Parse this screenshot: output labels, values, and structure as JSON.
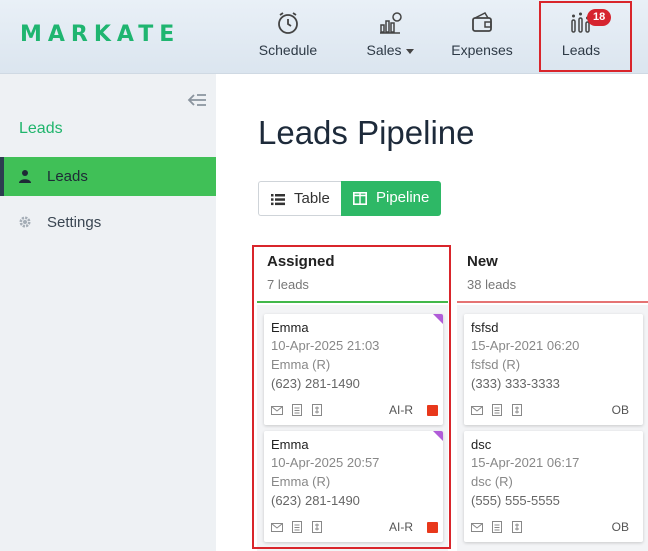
{
  "header": {
    "logo": "MARKATE",
    "nav": [
      {
        "label": "Schedule",
        "icon": "clock-icon"
      },
      {
        "label": "Sales",
        "icon": "bar-chart-dollar-icon"
      },
      {
        "label": "Expenses",
        "icon": "wallet-icon"
      },
      {
        "label": "Leads",
        "icon": "pipeline-bars-icon",
        "badge": "18"
      }
    ]
  },
  "sidebar": {
    "title": "Leads",
    "items": [
      {
        "label": "Leads",
        "icon": "person-icon",
        "active": true
      },
      {
        "label": "Settings",
        "icon": "gear-icon",
        "active": false
      }
    ]
  },
  "main": {
    "title": "Leads Pipeline",
    "view_toggle": {
      "table_label": "Table",
      "pipeline_label": "Pipeline",
      "active": "Pipeline"
    },
    "columns": [
      {
        "name": "Assigned",
        "count": "7 leads",
        "color": "#42b84a",
        "cards": [
          {
            "name": "Emma",
            "date": "10-Apr-2025 21:03",
            "owner": "Emma (R)",
            "phone": "(623) 281-1490",
            "tag": "AI-R",
            "status_color": "#e8381b",
            "flag_color": "#b05cd8"
          },
          {
            "name": "Emma",
            "date": "10-Apr-2025 20:57",
            "owner": "Emma (R)",
            "phone": "(623) 281-1490",
            "tag": "AI-R",
            "status_color": "#e8381b",
            "flag_color": "#b05cd8"
          }
        ]
      },
      {
        "name": "New",
        "count": "38 leads",
        "color": "#e57373",
        "cards": [
          {
            "name": "fsfsd",
            "date": "15-Apr-2021 06:20",
            "owner": "fsfsd (R)",
            "phone": "(333) 333-3333",
            "tag": "OB"
          },
          {
            "name": "dsc",
            "date": "15-Apr-2021 06:17",
            "owner": "dsc (R)",
            "phone": "(555) 555-5555",
            "tag": "OB"
          }
        ]
      }
    ]
  }
}
